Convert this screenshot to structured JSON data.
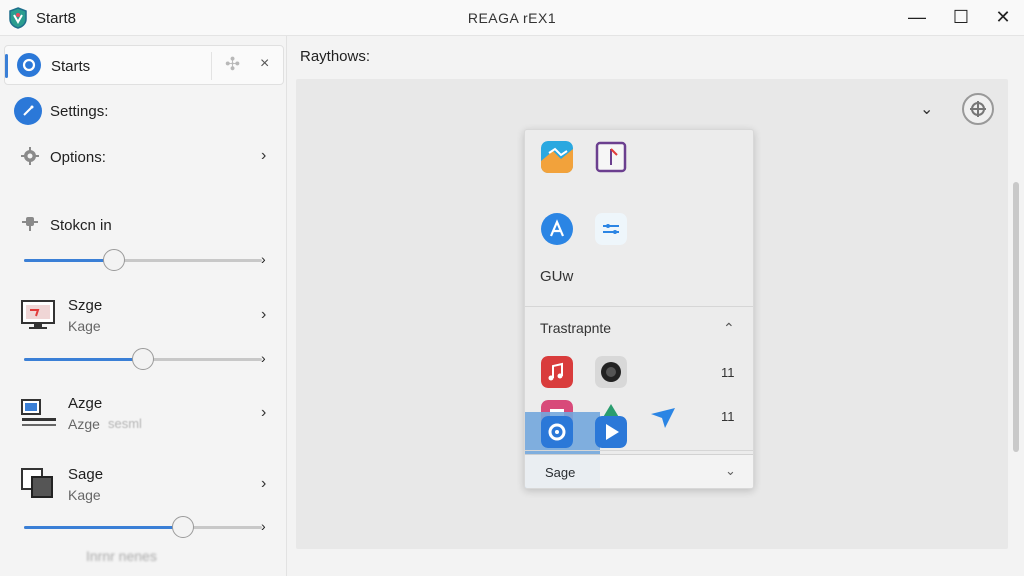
{
  "window": {
    "app_title": "Start8",
    "center_title": "REAGA rEX1",
    "controls": {
      "minimize": "—",
      "maximize": "☐",
      "close": "✕"
    }
  },
  "sidebar": {
    "active_tab": {
      "label": "Starts",
      "pin": "✣",
      "close": "×"
    },
    "settings": {
      "label": "Settings:"
    },
    "options": {
      "label": "Options:",
      "chevron": "›"
    },
    "stokcn": {
      "label": "Stokcn in"
    },
    "sliders": [
      {
        "value": 0.38
      },
      {
        "value": 0.5
      },
      {
        "value": 0.67
      }
    ],
    "slider_arrow": "›",
    "devices": [
      {
        "title": "Szge",
        "subtitle": "Kage",
        "chevron": "›",
        "icon": "monitor-alert-icon"
      },
      {
        "title": "Azge",
        "subtitle": "Azge",
        "faded": "sesml",
        "chevron": "›",
        "icon": "monitor-keyboard-icon"
      },
      {
        "title": "Sage",
        "subtitle": "Kage",
        "chevron": "›",
        "icon": "window-stack-icon"
      }
    ],
    "footer": "Inrnr nenes"
  },
  "main": {
    "heading": "Raythows:",
    "chevron": "⌄",
    "popup": {
      "label_a": "GUw",
      "section_title": "Trastrapnte",
      "section_chevron": "⌃",
      "nums": [
        "11",
        "11"
      ],
      "bottom_label": "Sage",
      "bottom_chevron": "⌄"
    }
  },
  "colors": {
    "accent": "#3a7fd6",
    "window_bg": "#f3f3f3",
    "canvas_bg": "#e8e8e8"
  }
}
